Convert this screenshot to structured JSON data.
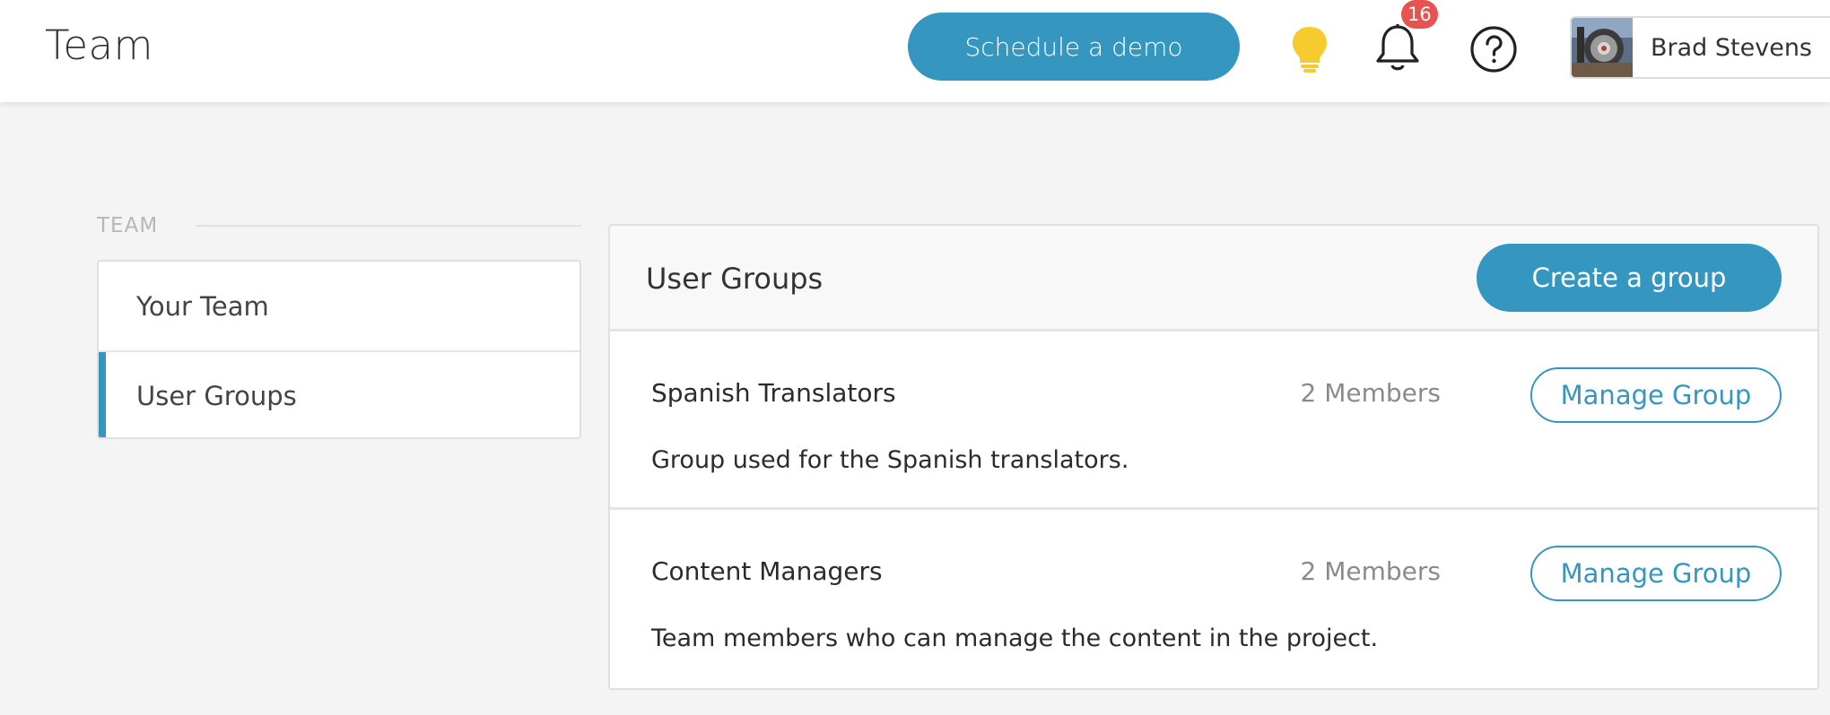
{
  "header": {
    "title": "Team",
    "demo_button": "Schedule a demo",
    "notification_count": "16",
    "user_name": "Brad Stevens",
    "icons": {
      "bulb": "lightbulb-icon",
      "bell": "bell-icon",
      "help": "help-circle-icon"
    }
  },
  "sidebar": {
    "section_label": "TEAM",
    "items": [
      {
        "label": "Your Team",
        "active": false
      },
      {
        "label": "User Groups",
        "active": true
      }
    ]
  },
  "main": {
    "title": "User Groups",
    "create_button": "Create a group",
    "groups": [
      {
        "name": "Spanish Translators",
        "members": "2 Members",
        "manage_label": "Manage Group",
        "description": "Group used for the Spanish translators."
      },
      {
        "name": "Content Managers",
        "members": "2 Members",
        "manage_label": "Manage Group",
        "description": "Team members who can manage the content in the project."
      }
    ]
  },
  "colors": {
    "accent": "#3597c0",
    "bulb": "#f5cb2f",
    "badge": "#e8524f"
  }
}
